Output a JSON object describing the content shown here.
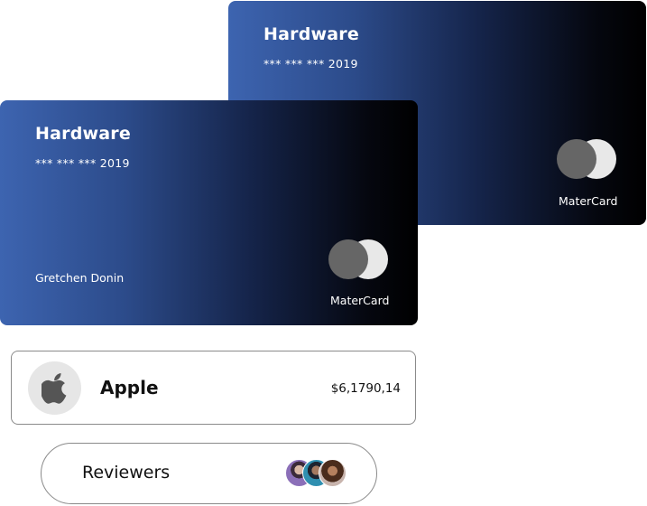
{
  "cards": [
    {
      "title": "Hardware",
      "number": "*** *** *** 2019",
      "brand": "MaterCard"
    },
    {
      "title": "Hardware",
      "number": "*** *** *** 2019",
      "holder": "Gretchen Donin",
      "brand": "MaterCard"
    }
  ],
  "transaction": {
    "icon": "apple-logo-icon",
    "merchant": "Apple",
    "amount": "$6,1790,14"
  },
  "reviewers": {
    "label": "Reviewers",
    "avatars": [
      "reviewer-avatar",
      "reviewer-avatar",
      "reviewer-avatar"
    ]
  },
  "colors": {
    "card_gradient_start": "#3d64b0",
    "card_gradient_end": "#000000",
    "mc_dark_circle": "#666666",
    "mc_light_circle": "#e8e8e8"
  }
}
